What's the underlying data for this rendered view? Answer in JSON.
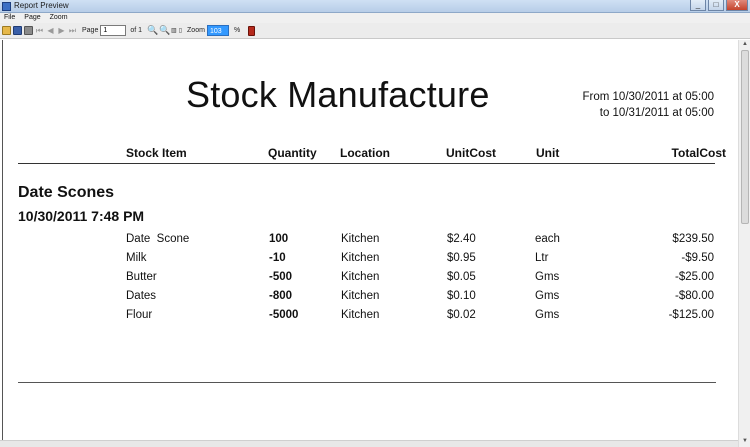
{
  "window": {
    "title": "Report Preview",
    "controls": [
      "_",
      "□",
      "X"
    ]
  },
  "menu": [
    "File",
    "Page",
    "Zoom"
  ],
  "toolbar": {
    "page_label": "Page",
    "page_value": "1",
    "page_of": "of 1",
    "zoom_label": "Zoom",
    "zoom_value": "103",
    "zoom_unit": "%",
    "icons": [
      "open-icon",
      "save-icon",
      "print-icon",
      "first-page-icon",
      "prev-page-icon",
      "next-page-icon",
      "last-page-icon",
      "zoom-in-icon",
      "zoom-out-icon",
      "exit-icon"
    ]
  },
  "report": {
    "title": "Stock Manufacture",
    "date_from": "From 10/30/2011 at 05:00",
    "date_to": "to 10/31/2011 at 05:00",
    "columns": [
      "Stock Item",
      "Quantity",
      "Location",
      "UnitCost",
      "Unit",
      "TotalCost"
    ],
    "group": {
      "name": "Date Scones",
      "datetime": "10/30/2011 7:48 PM",
      "rows": [
        {
          "item": "Date  Scone",
          "quantity": "100",
          "location": "Kitchen",
          "unit_cost": "$2.40",
          "unit": "each",
          "total": "$239.50"
        },
        {
          "item": "Milk",
          "quantity": "-10",
          "location": "Kitchen",
          "unit_cost": "$0.95",
          "unit": "Ltr",
          "total": "-$9.50"
        },
        {
          "item": "Butter",
          "quantity": "-500",
          "location": "Kitchen",
          "unit_cost": "$0.05",
          "unit": "Gms",
          "total": "-$25.00"
        },
        {
          "item": "Dates",
          "quantity": "-800",
          "location": "Kitchen",
          "unit_cost": "$0.10",
          "unit": "Gms",
          "total": "-$80.00"
        },
        {
          "item": "Flour",
          "quantity": "-5000",
          "location": "Kitchen",
          "unit_cost": "$0.02",
          "unit": "Gms",
          "total": "-$125.00"
        }
      ]
    }
  }
}
